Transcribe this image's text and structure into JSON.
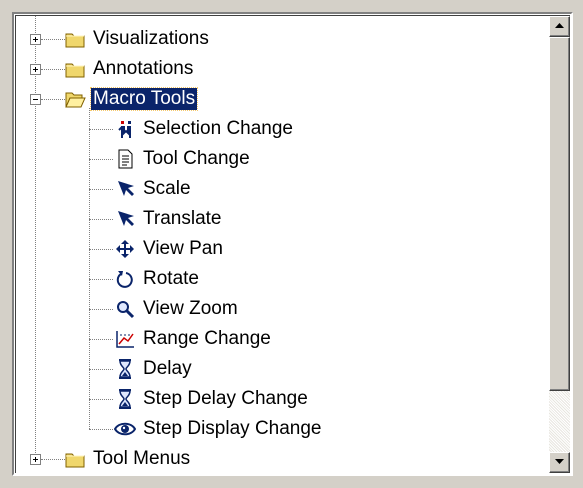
{
  "tree": {
    "items": [
      {
        "label": "Visualizations",
        "icon": "folder-closed-icon",
        "expander": "+"
      },
      {
        "label": "Annotations",
        "icon": "folder-closed-icon",
        "expander": "+"
      },
      {
        "label": "Macro Tools",
        "icon": "folder-open-icon",
        "expander": "-",
        "selected": true,
        "children": [
          {
            "label": "Selection Change",
            "icon": "selection-change-icon"
          },
          {
            "label": "Tool Change",
            "icon": "tool-change-icon"
          },
          {
            "label": "Scale",
            "icon": "arrow-cursor-icon"
          },
          {
            "label": "Translate",
            "icon": "arrow-cursor-icon"
          },
          {
            "label": "View Pan",
            "icon": "pan-arrows-icon"
          },
          {
            "label": "Rotate",
            "icon": "rotate-icon"
          },
          {
            "label": "View Zoom",
            "icon": "magnifier-icon"
          },
          {
            "label": "Range Change",
            "icon": "range-chart-icon"
          },
          {
            "label": "Delay",
            "icon": "hourglass-icon"
          },
          {
            "label": "Step Delay Change",
            "icon": "hourglass-icon"
          },
          {
            "label": "Step Display Change",
            "icon": "eye-icon"
          }
        ]
      },
      {
        "label": "Tool Menus",
        "icon": "folder-closed-icon",
        "expander": "+"
      }
    ]
  },
  "scrollbar": {
    "up_icon": "scroll-up-arrow-icon",
    "down_icon": "scroll-down-arrow-icon",
    "position": 0.0,
    "visible_fraction": 0.85
  },
  "colors": {
    "selection_bg": "#0a246a",
    "folder_yellow": "#f0d76c",
    "icon_blue": "#0a246a"
  }
}
